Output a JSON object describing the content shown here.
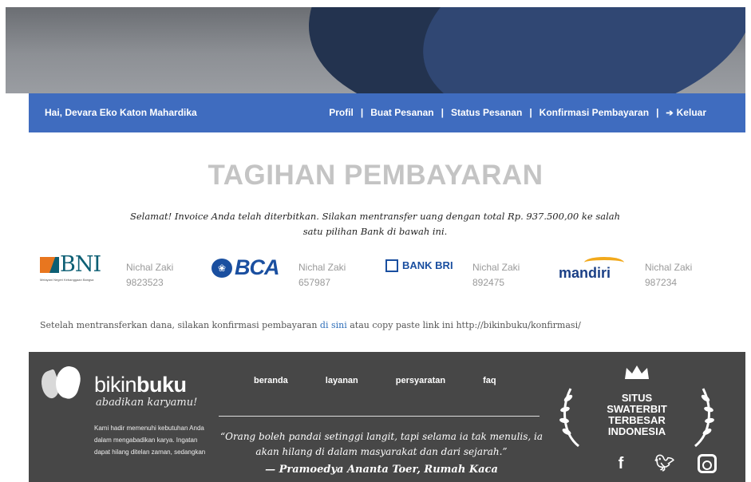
{
  "header": {
    "greeting": "Hai, Devara Eko Katon Mahardika",
    "nav": [
      "Profil",
      "Buat Pesanan",
      "Status Pesanan",
      "Konfirmasi Pembayaran"
    ],
    "separator": "|",
    "logout": "Keluar",
    "colors": {
      "nav_bg": "#3f6cbf"
    }
  },
  "main": {
    "title": "TAGIHAN PEMBAYARAN",
    "message": "Selamat! Invoice Anda telah diterbitkan. Silakan mentransfer uang dengan total Rp. 937.500,00 ke salah satu pilihan Bank di bawah ini.",
    "banks": [
      {
        "logo": "BNI",
        "logo_sub": "Melayani Negeri Kebanggaan Bangsa",
        "name": "Nichal Zaki",
        "account": "9823523"
      },
      {
        "logo": "BCA",
        "name": "Nichal Zaki",
        "account": "657987"
      },
      {
        "logo": "BANK BRI",
        "name": "Nichal Zaki",
        "account": "892475"
      },
      {
        "logo": "mandiri",
        "name": "Nichal Zaki",
        "account": "987234"
      }
    ],
    "confirm_text_before": "Setelah mentransferkan dana, silakan konfirmasi pembayaran ",
    "confirm_link": "di sini",
    "confirm_text_after": " atau copy paste link ini http://bikinbuku/konfirmasi/"
  },
  "footer": {
    "brand_light": "bikin",
    "brand_bold": "buku",
    "tagline": "abadikan karyamu!",
    "description": "Kami hadir memenuhi kebutuhan Anda dalam mengabadikan karya. Ingatan dapat hilang ditelan zaman, sedangkan",
    "nav": [
      "beranda",
      "layanan",
      "persyaratan",
      "faq"
    ],
    "quote": "“Orang boleh pandai setinggi langit, tapi selama ia tak menulis, ia akan hilang di dalam masyarakat dan dari sejarah.”",
    "author": "— Pramoedya Ananta Toer, Rumah Kaca",
    "award_lines": [
      "SITUS",
      "SWATERBIT",
      "TERBESAR",
      "INDONESIA"
    ],
    "social": [
      "facebook-icon",
      "twitter-icon",
      "instagram-icon"
    ],
    "colors": {
      "footer_bg": "#474747"
    }
  }
}
